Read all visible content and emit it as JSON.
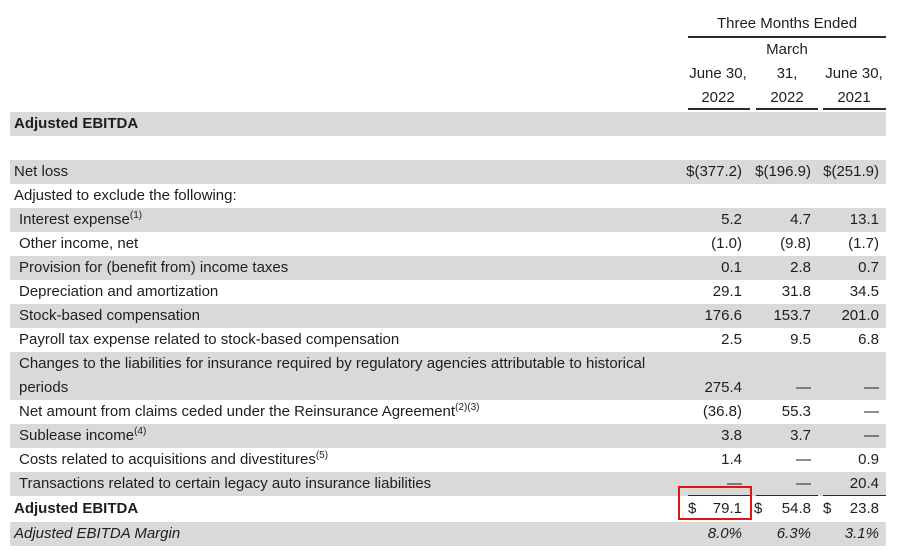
{
  "header": {
    "group_title": "Three Months Ended",
    "col1": {
      "line1": "June 30,",
      "line2": "2022"
    },
    "col2": {
      "line1": "March",
      "line2": "31,",
      "line3": "2022"
    },
    "col3": {
      "line1": "June 30,",
      "line2": "2021"
    }
  },
  "section_title": "Adjusted EBITDA",
  "rows": {
    "net_loss": {
      "label": "Net loss",
      "v1": "$(377.2)",
      "v2": "$(196.9)",
      "v3": "$(251.9)"
    },
    "adjusted_exclude": {
      "label": "Adjusted to exclude the following:"
    },
    "interest": {
      "label": "Interest expense",
      "note": "(1)",
      "v1": "5.2",
      "v2": "4.7",
      "v3": "13.1"
    },
    "other_income": {
      "label": "Other income, net",
      "v1": "(1.0)",
      "v2": "(9.8)",
      "v3": "(1.7)"
    },
    "provision": {
      "label": "Provision for (benefit from) income taxes",
      "v1": "0.1",
      "v2": "2.8",
      "v3": "0.7"
    },
    "depreciation": {
      "label": "Depreciation and amortization",
      "v1": "29.1",
      "v2": "31.8",
      "v3": "34.5"
    },
    "stock_comp": {
      "label": "Stock-based compensation",
      "v1": "176.6",
      "v2": "153.7",
      "v3": "201.0"
    },
    "payroll_tax": {
      "label": "Payroll tax expense related to stock-based compensation",
      "v1": "2.5",
      "v2": "9.5",
      "v3": "6.8"
    },
    "liabilities": {
      "label_line1": "Changes to the liabilities for insurance required by regulatory agencies attributable to historical",
      "label_line2": "periods",
      "v1": "275.4",
      "v2": "—",
      "v3": "—"
    },
    "reinsurance": {
      "label": "Net amount from claims ceded under the Reinsurance Agreement",
      "note": "(2)(3)",
      "v1": "(36.8)",
      "v2": "55.3",
      "v3": "—"
    },
    "sublease": {
      "label": "Sublease income",
      "note": "(4)",
      "v1": "3.8",
      "v2": "3.7",
      "v3": "—"
    },
    "acquisitions": {
      "label": "Costs related to acquisitions and divestitures",
      "note": "(5)",
      "v1": "1.4",
      "v2": "—",
      "v3": "0.9"
    },
    "legacy_auto": {
      "label": "Transactions related to certain legacy auto insurance liabilities",
      "v1": "—",
      "v2": "—",
      "v3": "20.4"
    },
    "adjusted_ebitda": {
      "label": "Adjusted EBITDA",
      "dollar": "$",
      "v1": "79.1",
      "v2": "54.8",
      "v3": "23.8"
    },
    "margin": {
      "label": "Adjusted EBITDA Margin",
      "v1": "8.0%",
      "v2": "6.3%",
      "v3": "3.1%"
    }
  },
  "highlight_color": "#e01515"
}
